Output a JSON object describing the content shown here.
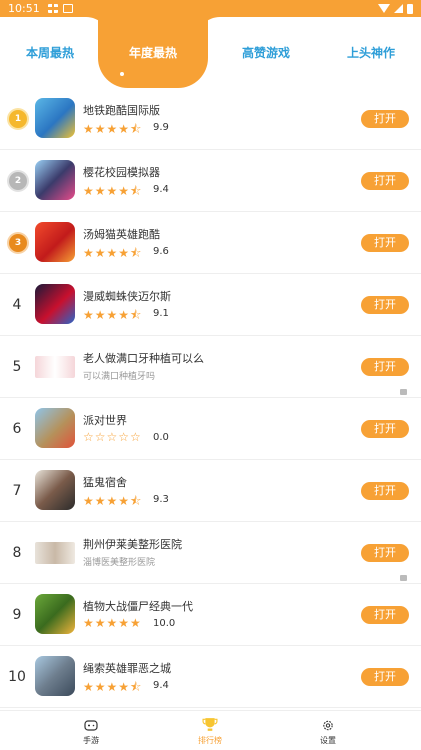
{
  "status_bar": {
    "time": "10:51"
  },
  "tabs": [
    {
      "label": "本周最热"
    },
    {
      "label": "年度最热"
    },
    {
      "label": "高赞游戏"
    },
    {
      "label": "上头神作"
    }
  ],
  "list": [
    {
      "rank": "1",
      "name": "地铁跑酷国际版",
      "stars": "★★★★⯪",
      "score": "9.9",
      "button": "打开"
    },
    {
      "rank": "2",
      "name": "樱花校园模拟器",
      "stars": "★★★★⯪",
      "score": "9.4",
      "button": "打开"
    },
    {
      "rank": "3",
      "name": "汤姆猫英雄跑酷",
      "stars": "★★★★⯪",
      "score": "9.6",
      "button": "打开"
    },
    {
      "rank": "4",
      "name": "漫威蜘蛛侠迈尔斯",
      "stars": "★★★★⯪",
      "score": "9.1",
      "button": "打开"
    },
    {
      "rank": "5",
      "name": "老人做满口牙种植可以么",
      "subtitle": "可以满口种植牙吗",
      "button": "打开"
    },
    {
      "rank": "6",
      "name": "派对世界",
      "stars": "☆☆☆☆☆",
      "score": "0.0",
      "button": "打开"
    },
    {
      "rank": "7",
      "name": "猛鬼宿舍",
      "stars": "★★★★⯪",
      "score": "9.3",
      "button": "打开"
    },
    {
      "rank": "8",
      "name": "荆州伊莱美整形医院",
      "subtitle": "淄博医美整形医院",
      "button": "打开"
    },
    {
      "rank": "9",
      "name": "植物大战僵尸经典一代",
      "stars": "★★★★★",
      "score": "10.0",
      "button": "打开"
    },
    {
      "rank": "10",
      "name": "绳索英雄罪恶之城",
      "stars": "★★★★⯪",
      "score": "9.4",
      "button": "打开"
    }
  ],
  "bottom_nav": [
    {
      "label": "手游",
      "icon": "gamepad-icon"
    },
    {
      "label": "排行榜",
      "icon": "trophy-icon"
    },
    {
      "label": "设置",
      "icon": "gear-icon"
    }
  ],
  "colors": {
    "accent": "#f7a135",
    "tab_text": "#2e9ed8"
  }
}
